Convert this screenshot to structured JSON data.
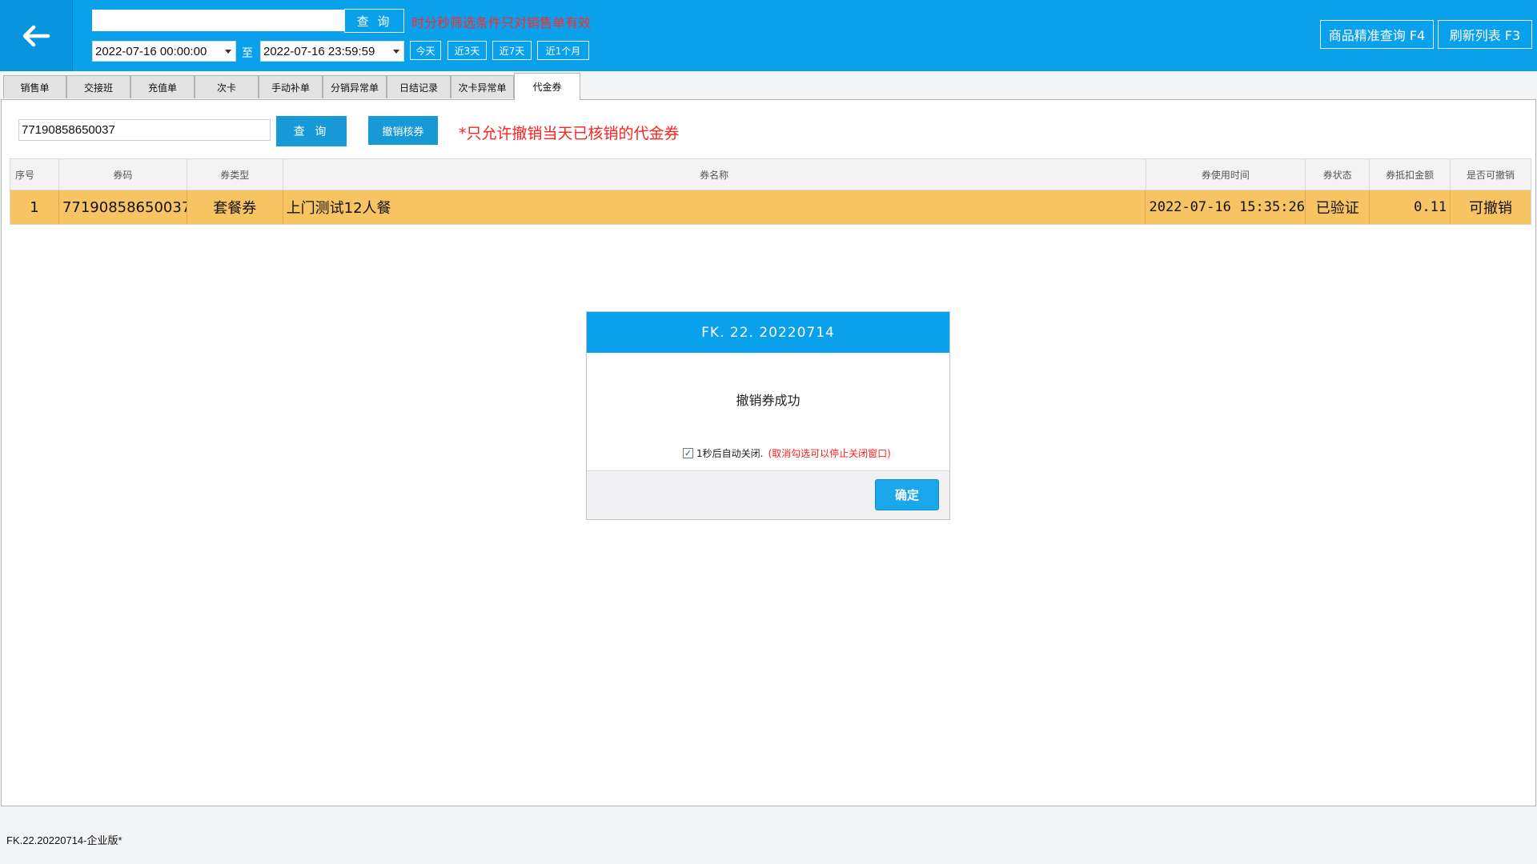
{
  "topbar": {
    "search_value": "",
    "query_label": "查 询",
    "time_hint": "时分秒筛选条件只对销售单有效",
    "date_from": "2022-07-16 00:00:00",
    "date_sep": "至",
    "date_to": "2022-07-16 23:59:59",
    "quick": [
      "今天",
      "近3天",
      "近7天",
      "近1个月"
    ],
    "product_query_label": "商品精准查询 F4",
    "refresh_label": "刷新列表 F3"
  },
  "tabs": [
    "销售单",
    "交接班",
    "充值单",
    "次卡",
    "手动补单",
    "分销异常单",
    "日结记录",
    "次卡异常单",
    "代金券"
  ],
  "active_tab": "代金券",
  "panel": {
    "code_value": "77190858650037",
    "query_label": "查 询",
    "revoke_label": "撤销核券",
    "warning": "*只允许撤销当天已核销的代金券"
  },
  "table": {
    "headers": [
      "序号",
      "券码",
      "券类型",
      "券名称",
      "券使用时间",
      "券状态",
      "券抵扣金额",
      "是否可撤销"
    ],
    "rows": [
      [
        "1",
        "77190858650037",
        "套餐券",
        "上门测试12人餐",
        "2022-07-16 15:35:26",
        "已验证",
        "0.11",
        "可撤销"
      ]
    ]
  },
  "modal": {
    "title": "FK. 22. 20220714",
    "message": "撤销券成功",
    "auto_close_label": "1秒后自动关闭.",
    "auto_close_note": "(取消勾选可以停止关闭窗口)",
    "auto_close_checked": true,
    "ok_label": "确定"
  },
  "status": {
    "text": "FK.22.20220714-企业版*"
  },
  "colors": {
    "topbar": "#0aa1ec",
    "accent_button": "#1899d7",
    "selected_row": "#f8c463",
    "warning_red": "#ff2020"
  }
}
